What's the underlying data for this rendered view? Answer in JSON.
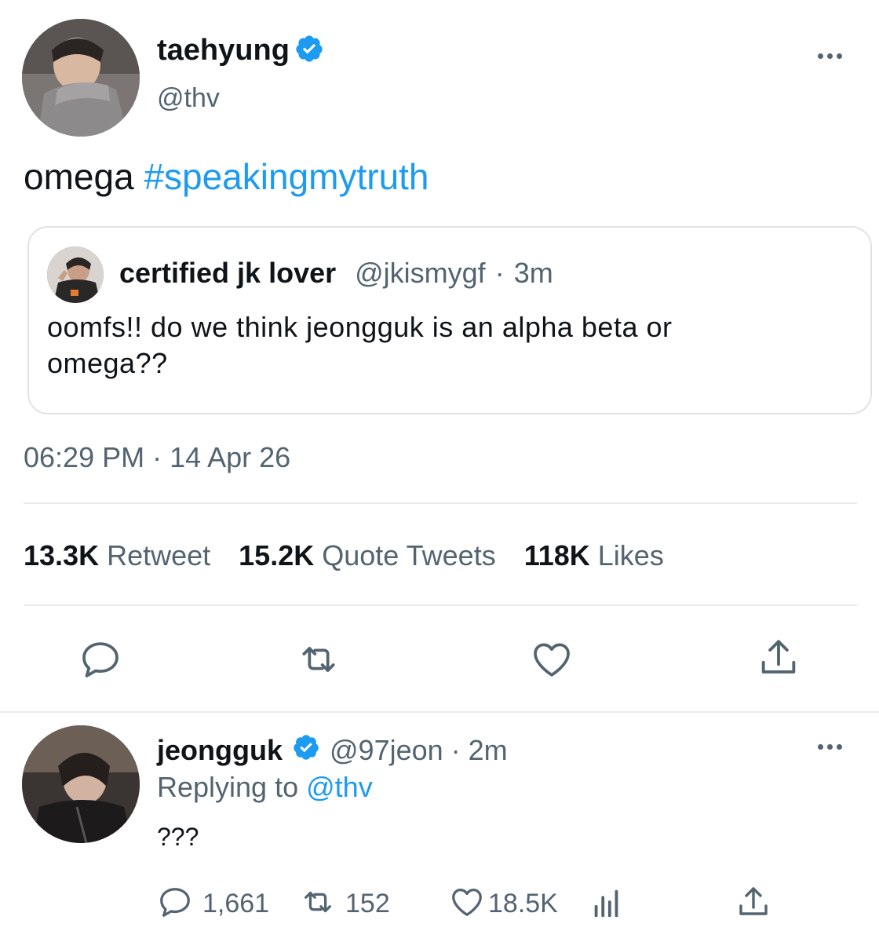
{
  "tweet": {
    "display_name": "taehyung",
    "handle": "@thv",
    "text_plain": "omega",
    "hashtag": "#speakingmytruth",
    "timestamp": "06:29 PM · 14 Apr 26",
    "more_icon": "more-horizontal-icon",
    "quote": {
      "display_name": "certified jk lover",
      "handle": "@jkismygf",
      "separator": "·",
      "time": "3m",
      "text": "oomfs!! do we think jeongguk is an alpha beta or omega??"
    },
    "stats": {
      "retweets_count": "13.3K",
      "retweets_label": "Retweet",
      "quotes_count": "15.2K",
      "quotes_label": "Quote Tweets",
      "likes_count": "118K",
      "likes_label": "Likes"
    },
    "actions": [
      "reply-icon",
      "retweet-icon",
      "like-icon",
      "share-icon"
    ]
  },
  "reply": {
    "display_name": "jeongguk",
    "handle": "@97jeon",
    "separator": "·",
    "time": "2m",
    "replying_prefix": "Replying to",
    "replying_to": "@thv",
    "text": "???",
    "counts": {
      "replies": "1,661",
      "retweets": "152",
      "likes": "18.5K"
    },
    "actions": [
      "reply-icon",
      "retweet-icon",
      "like-icon",
      "analytics-icon",
      "share-icon"
    ]
  },
  "colors": {
    "accent": "#1d9bf0",
    "text": "#0f1419",
    "secondary": "#536471",
    "border": "#dfe3e6"
  }
}
